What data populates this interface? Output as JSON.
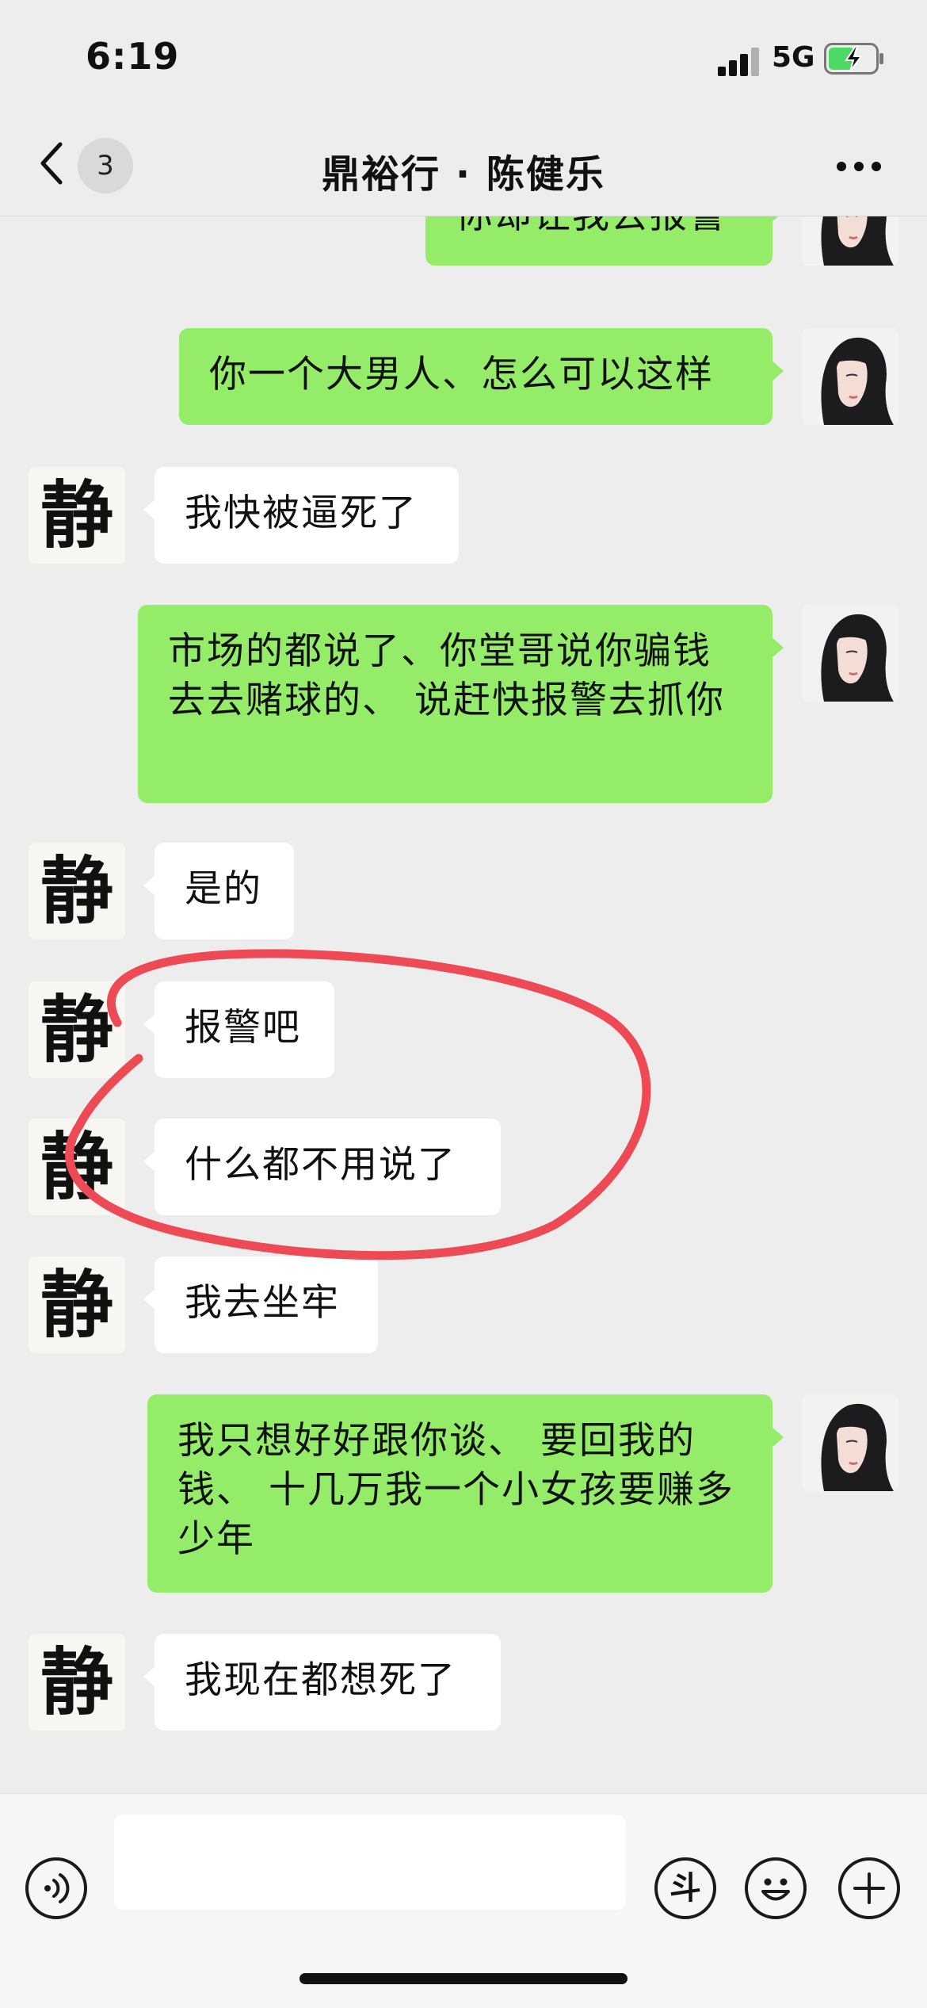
{
  "status_bar": {
    "time": "6:19",
    "network": "5G"
  },
  "nav": {
    "unread_count": "3",
    "title": "鼎裕行 · 陈健乐"
  },
  "messages": [
    {
      "side": "out",
      "text": "你却让我去报警"
    },
    {
      "side": "out",
      "text": "你一个大男人、怎么可以这样"
    },
    {
      "side": "in",
      "text": "我快被逼死了"
    },
    {
      "side": "out",
      "text": "市场的都说了、你堂哥说你骗钱去去赌球的、  说赶快报警去抓你"
    },
    {
      "side": "in",
      "text": "是的"
    },
    {
      "side": "in",
      "text": "报警吧"
    },
    {
      "side": "in",
      "text": "什么都不用说了"
    },
    {
      "side": "in",
      "text": "我去坐牢"
    },
    {
      "side": "out",
      "text": "我只想好好跟你谈、  要回我的钱、  十几万我一个小女孩要赚多少年"
    },
    {
      "side": "in",
      "text": "我现在都想死了"
    }
  ],
  "contact_avatar_glyph": "静",
  "input_bar": {
    "douyin_glyph": "斗",
    "input_value": ""
  },
  "colors": {
    "outgoing_bubble": "#95ec69",
    "incoming_bubble": "#ffffff",
    "annotation": "#ee4a55"
  },
  "icons": [
    "back-chevron-icon",
    "more-icon",
    "voice-icon",
    "douyin-icon",
    "emoji-icon",
    "plus-icon"
  ]
}
